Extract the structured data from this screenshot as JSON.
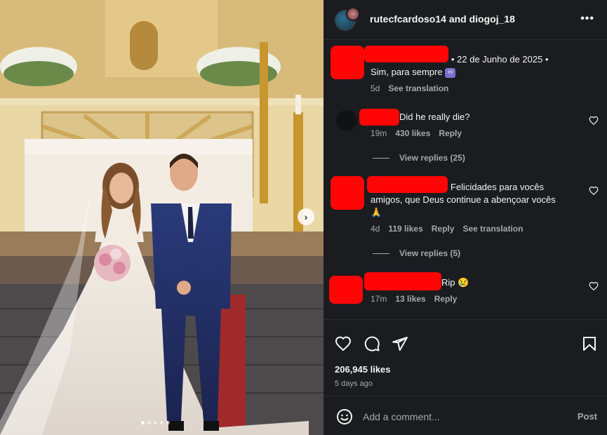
{
  "header": {
    "user1": "rutecfcardoso14",
    "and": "and",
    "user2": "diogoj_18",
    "more": "•••"
  },
  "carousel": {
    "next": "›",
    "dots_total": 5,
    "dots_active": 1
  },
  "caption": {
    "date": "• 22 de Junho de 2025 •",
    "text": "Sim, para sempre",
    "emoji": "♾",
    "age": "5d",
    "translate": "See translation"
  },
  "comments": [
    {
      "text": "Did he really die?",
      "age": "19m",
      "likes": "430 likes",
      "reply": "Reply",
      "view_replies": "View replies (25)"
    },
    {
      "text_line1": "Felicidades para vocês",
      "text_line2": "amigos, que Deus continue a abençoar vocês",
      "emoji": "🙏",
      "age": "4d",
      "likes": "119 likes",
      "reply": "Reply",
      "translate": "See translation",
      "view_replies": "View replies (5)"
    },
    {
      "text": "Rip",
      "emoji": "😢",
      "age": "17m",
      "likes": "13 likes",
      "reply": "Reply"
    }
  ],
  "stats": {
    "likes": "206,945 likes",
    "ago": "5 days ago"
  },
  "composer": {
    "placeholder": "Add a comment...",
    "post": "Post"
  },
  "colors": {
    "panel_bg": "#1a1c20",
    "redaction": "#ff0505",
    "muted": "#a8a8a8"
  }
}
